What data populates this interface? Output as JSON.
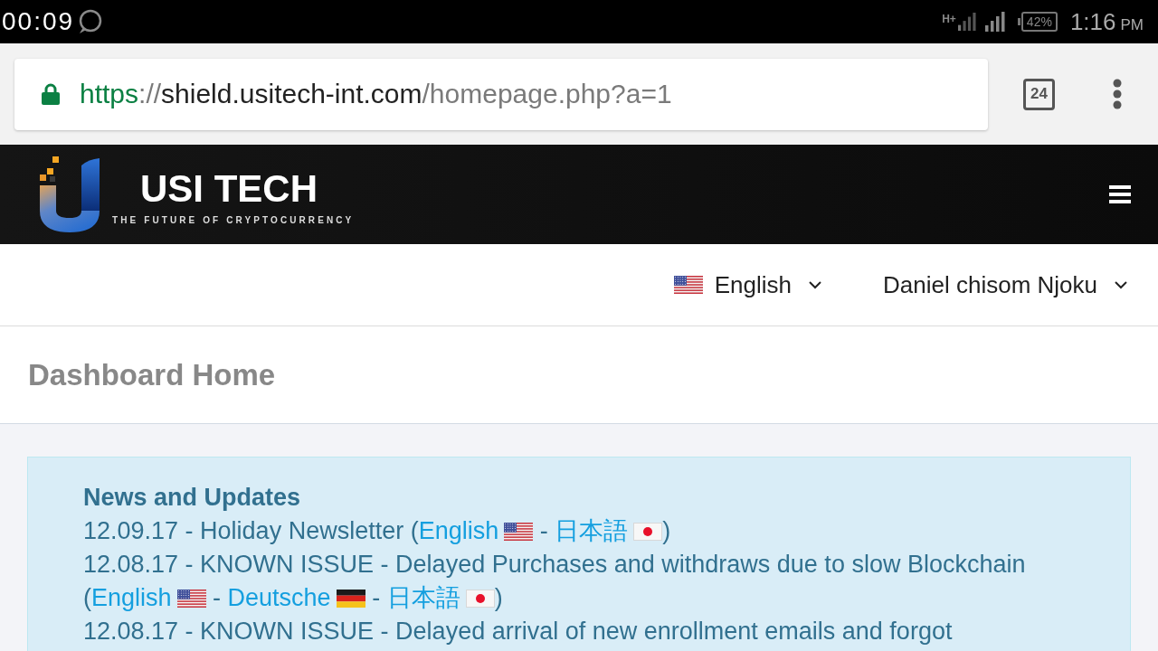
{
  "status_bar": {
    "recording_timer": "00:09",
    "network_type": "H+",
    "battery": "42%",
    "time": "1:16",
    "period": "PM"
  },
  "browser": {
    "secure": true,
    "url": {
      "scheme": "https",
      "separator": "://",
      "host": "shield.usitech-int.com",
      "path": "/homepage.php?a=1"
    },
    "tab_count": "24"
  },
  "header": {
    "brand": "USI TECH",
    "tagline": "THE FUTURE OF CRYPTOCURRENCY"
  },
  "top_nav": {
    "language": {
      "label": "English",
      "flag": {
        "kind": "us"
      }
    },
    "user": {
      "name": "Daniel chisom Njoku"
    }
  },
  "page_title": "Dashboard Home",
  "news": {
    "heading": "News and Updates",
    "items": [
      {
        "parts": [
          {
            "kind": "text",
            "text": "12.09.17 - Holiday Newsletter ("
          },
          {
            "kind": "link",
            "text": "English",
            "flag": {
              "kind": "us"
            }
          },
          {
            "kind": "text",
            "text": " - "
          },
          {
            "kind": "link",
            "text": "日本語",
            "flag": {
              "kind": "jp"
            }
          },
          {
            "kind": "text",
            "text": ")"
          }
        ]
      },
      {
        "parts": [
          {
            "kind": "text",
            "text": "12.08.17 - KNOWN ISSUE - Delayed Purchases and withdraws due to slow Blockchain ("
          },
          {
            "kind": "link",
            "text": "English",
            "flag": {
              "kind": "us"
            }
          },
          {
            "kind": "text",
            "text": " - "
          },
          {
            "kind": "link",
            "text": "Deutsche",
            "flag": {
              "kind": "de"
            }
          },
          {
            "kind": "text",
            "text": " - "
          },
          {
            "kind": "link",
            "text": "日本語",
            "flag": {
              "kind": "jp"
            }
          },
          {
            "kind": "text",
            "text": ")"
          }
        ]
      },
      {
        "parts": [
          {
            "kind": "text",
            "text": "12.08.17 - KNOWN ISSUE - Delayed arrival of new enrollment emails and forgot"
          }
        ]
      }
    ]
  }
}
